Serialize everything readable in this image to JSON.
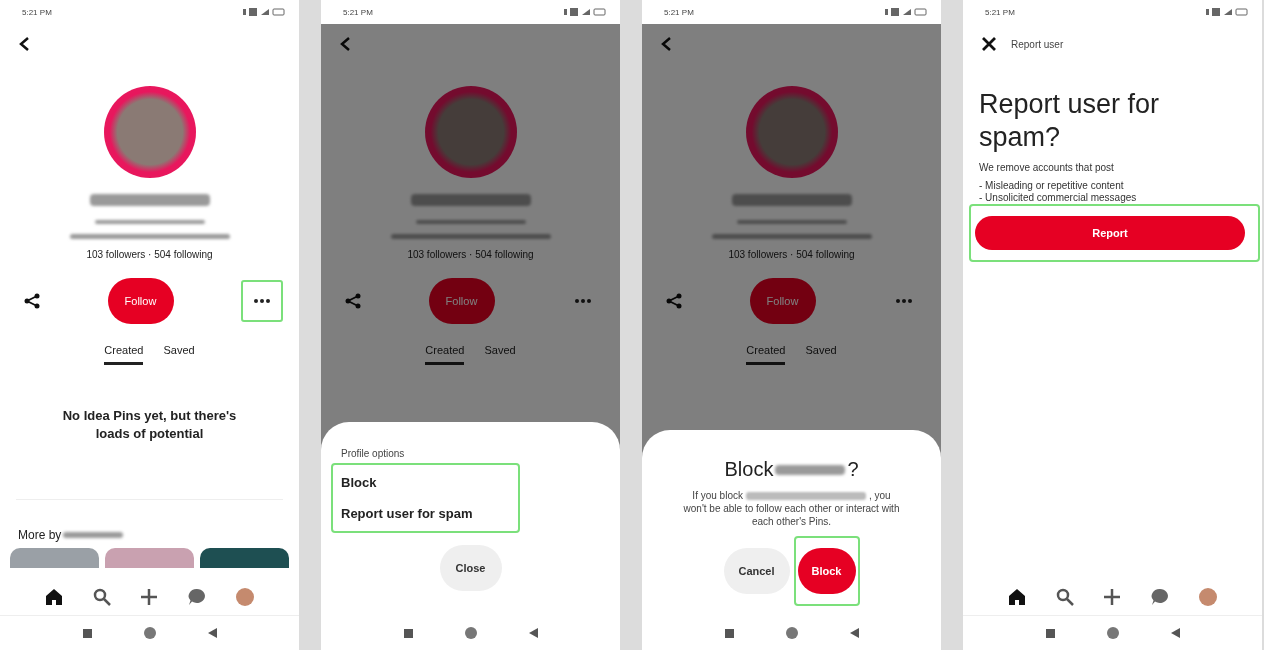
{
  "screens": [
    {
      "kind": "profile",
      "time": "5:21 PM",
      "dimmed": false,
      "profile": {
        "stats": "103 followers · 504 following",
        "follow": "Follow",
        "more_highlighted": true,
        "tabs": [
          {
            "label": "Created",
            "selected": true
          },
          {
            "label": "Saved",
            "selected": false
          }
        ],
        "empty_text": "No Idea Pins yet, but there's loads of potential",
        "more_by": "More by"
      },
      "nav": true
    },
    {
      "kind": "options_sheet",
      "time": "5:21 PM",
      "dimmed": true,
      "profile": {
        "stats": "103 followers · 504 following",
        "follow": "Follow",
        "more_highlighted": false,
        "tabs": [
          {
            "label": "Created",
            "selected": true
          },
          {
            "label": "Saved",
            "selected": false
          }
        ]
      },
      "sheet": {
        "title": "Profile options",
        "options": [
          "Block",
          "Report user for spam"
        ],
        "highlighted": true,
        "close": "Close"
      }
    },
    {
      "kind": "block_dialog",
      "time": "5:21 PM",
      "dimmed": true,
      "profile": {
        "stats": "103 followers · 504 following",
        "follow": "Follow",
        "more_highlighted": false,
        "tabs": [
          {
            "label": "Created",
            "selected": true
          },
          {
            "label": "Saved",
            "selected": false
          }
        ]
      },
      "dialog": {
        "title_start": "Block",
        "title_end": "?",
        "body_start": "If you block",
        "body_mid": ", you",
        "body_end": "won't be able to follow each other or interact with each other's Pins.",
        "cancel": "Cancel",
        "confirm": "Block",
        "confirm_highlighted": true
      }
    },
    {
      "kind": "report",
      "time": "5:21 PM",
      "dimmed": false,
      "report": {
        "header": "Report user",
        "title": "Report user for spam?",
        "intro": "We remove accounts that post",
        "bullets": [
          "- Misleading or repetitive content",
          "- Unsolicited commercial messages"
        ],
        "button": "Report",
        "highlighted": true
      },
      "nav": true
    }
  ]
}
